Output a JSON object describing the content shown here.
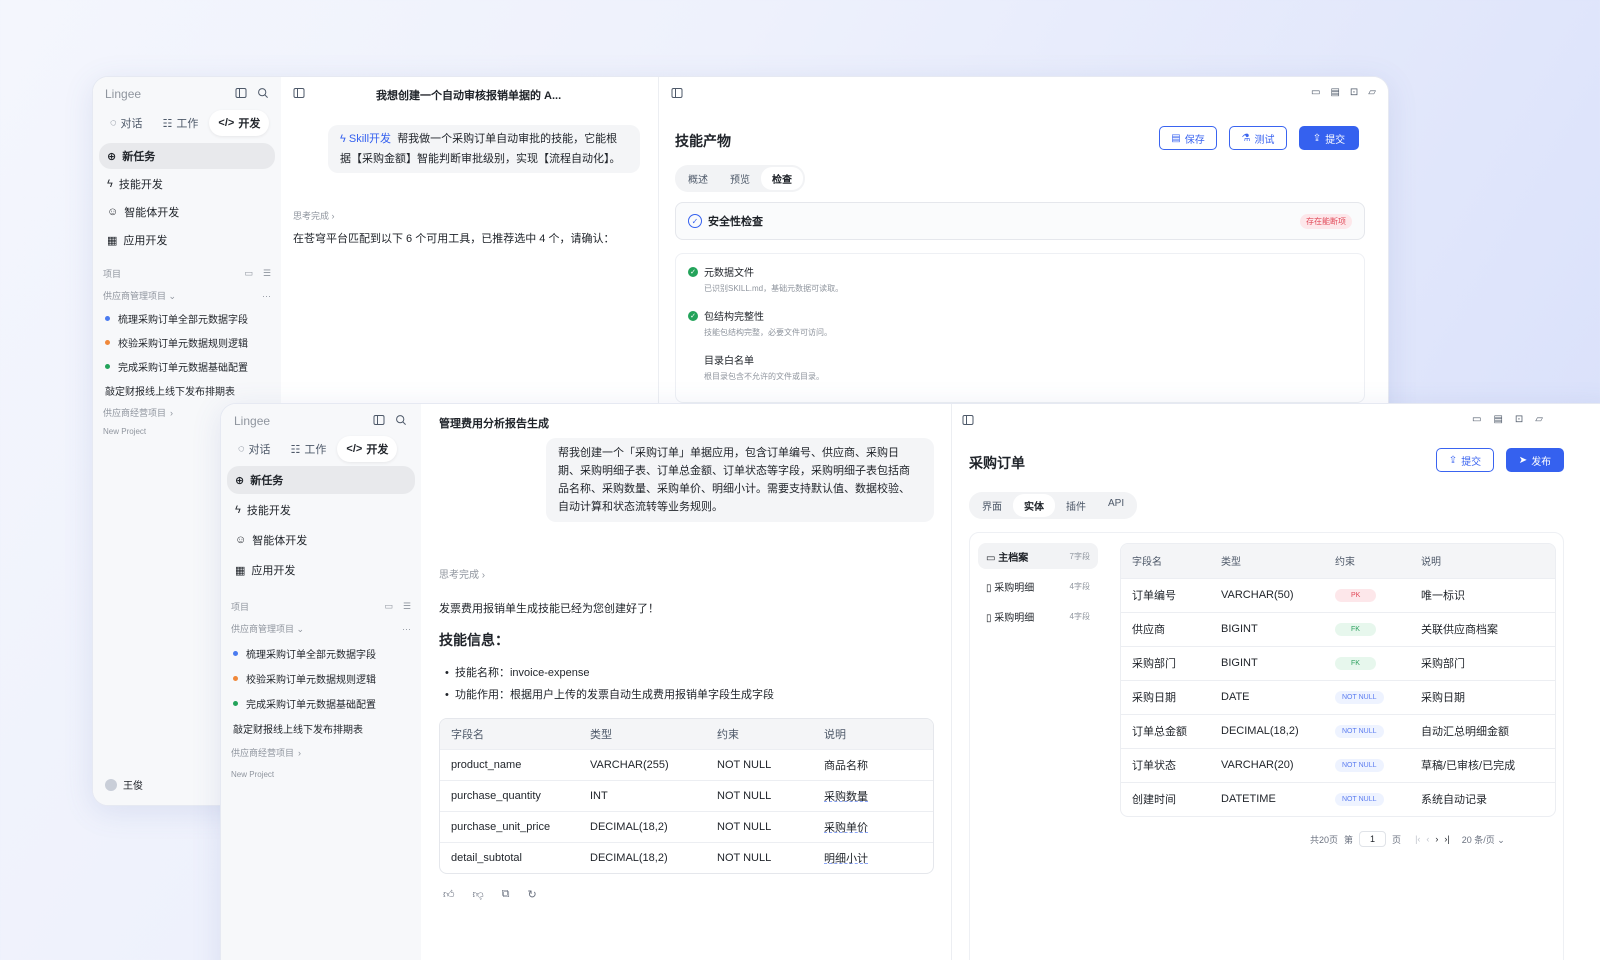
{
  "brand": "Lingee",
  "mode_tabs": {
    "chat": "对话",
    "work": "工作",
    "dev": "开发"
  },
  "nav": {
    "new_task": "新任务",
    "skill": "技能开发",
    "agent": "智能体开发",
    "app": "应用开发"
  },
  "projects": {
    "section": "项目",
    "group1": "供应商管理项目",
    "tasks": [
      "梳理采购订单全部元数据字段",
      "校验采购订单元数据规则逻辑",
      "完成采购订单元数据基础配置"
    ],
    "standalone": "敲定财报线上线下发布排期表",
    "group2": "供应商经营项目",
    "new_project": "New Project"
  },
  "user": {
    "name": "王俊",
    "help": "问"
  },
  "back": {
    "chat_title": "我想创建一个自动审核报销单据的 A...",
    "skill_tag": "Skill开发",
    "prompt_line1": "帮我做一个采购订单自动审批的技能，它能根",
    "prompt_line2": "据【采购金额】智能判断审批级别，实现【流程自动化】。",
    "think": "思考完成",
    "reply": "在苍穹平台匹配到以下 6 个可用工具，已推荐选中 4 个，请确认：",
    "panel_title": "技能产物",
    "btn_save": "保存",
    "btn_test": "测试",
    "btn_submit": "提交",
    "tabs": [
      "概述",
      "预览",
      "检查"
    ],
    "security_title": "安全性检查",
    "security_badge": "存在能断项",
    "checks": [
      {
        "title": "元数据文件",
        "desc": "已识别SKILL.md，基础元数据可读取。"
      },
      {
        "title": "包结构完整性",
        "desc": "技能包结构完整，必要文件可访问。"
      },
      {
        "title": "目录白名单",
        "desc": "根目录包含不允许的文件或目录。"
      }
    ]
  },
  "front": {
    "chat_title": "管理费用分析报告生成",
    "prompt": [
      "帮我创建一个「采购订单」单据应用，包含订单编号、供应商、采购日",
      "期、采购明细子表、订单总金额、订单状态等字段，采购明细子表包括商",
      "品名称、采购数量、采购单价、明细小计。需要支持默认值、数据校验、",
      "自动计算和状态流转等业务规则。"
    ],
    "think": "思考完成",
    "reply": "发票费用报销单生成技能已经为您创建好了！",
    "info_title": "技能信息：",
    "bullets": [
      "技能名称：invoice-expense",
      "功能作用：根据用户上传的发票自动生成费用报销单字段生成字段"
    ],
    "table": {
      "headers": [
        "字段名",
        "类型",
        "约束",
        "说明"
      ],
      "rows": [
        [
          "product_name",
          "VARCHAR(255)",
          "NOT NULL",
          "商品名称"
        ],
        [
          "purchase_quantity",
          "INT",
          "NOT NULL",
          "采购数量"
        ],
        [
          "purchase_unit_price",
          "DECIMAL(18,2)",
          "NOT NULL",
          "采购单价"
        ],
        [
          "detail_subtotal",
          "DECIMAL(18,2)",
          "NOT NULL",
          "明细小计"
        ]
      ]
    },
    "panel_title": "采购订单",
    "btn_submit": "提交",
    "btn_publish": "发布",
    "tabs": [
      "界面",
      "实体",
      "插件",
      "API"
    ],
    "entities": [
      {
        "name": "主档案",
        "count": "7字段"
      },
      {
        "name": "采购明细",
        "count": "4字段"
      },
      {
        "name": "采购明细",
        "count": "4字段"
      }
    ],
    "entity_table": {
      "headers": [
        "字段名",
        "类型",
        "约束",
        "说明"
      ],
      "rows": [
        {
          "name": "订单编号",
          "type": "VARCHAR(50)",
          "tag": "PK",
          "desc": "唯一标识"
        },
        {
          "name": "供应商",
          "type": "BIGINT",
          "tag": "FK",
          "desc": "关联供应商档案"
        },
        {
          "name": "采购部门",
          "type": "BIGINT",
          "tag": "FK",
          "desc": "采购部门"
        },
        {
          "name": "采购日期",
          "type": "DATE",
          "tag": "NOT NULL",
          "desc": "采购日期"
        },
        {
          "name": "订单总金额",
          "type": "DECIMAL(18,2)",
          "tag": "NOT NULL",
          "desc": "自动汇总明细金额"
        },
        {
          "name": "订单状态",
          "type": "VARCHAR(20)",
          "tag": "NOT NULL",
          "desc": "草稿/已审核/已完成"
        },
        {
          "name": "创建时间",
          "type": "DATETIME",
          "tag": "NOT NULL",
          "desc": "系统自动记录"
        }
      ]
    },
    "pagination": {
      "total": "共20页",
      "prefix": "第",
      "page": "1",
      "suffix": "页",
      "size": "20 条/页"
    }
  },
  "colors": {
    "accent": "#3561ef",
    "green": "#23a35a",
    "orange": "#f0883a",
    "blue": "#4a7bf0"
  }
}
